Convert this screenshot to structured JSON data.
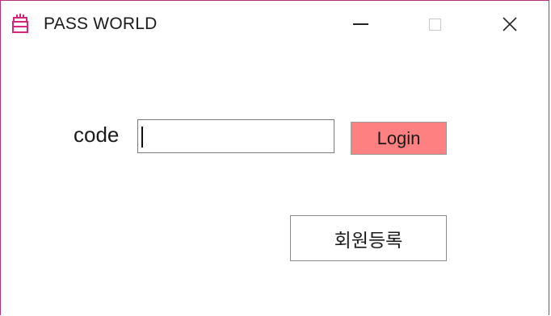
{
  "window": {
    "title": "PASS WORLD",
    "app_icon": "cake-icon",
    "minimize_icon": "minimize-icon",
    "maximize_icon": "maximize-icon",
    "close_icon": "close-icon",
    "accent_color": "#b5317a"
  },
  "form": {
    "code_label": "code",
    "code_value": "",
    "login_label": "Login",
    "login_color": "#ff8080",
    "register_label": "회원등록"
  }
}
